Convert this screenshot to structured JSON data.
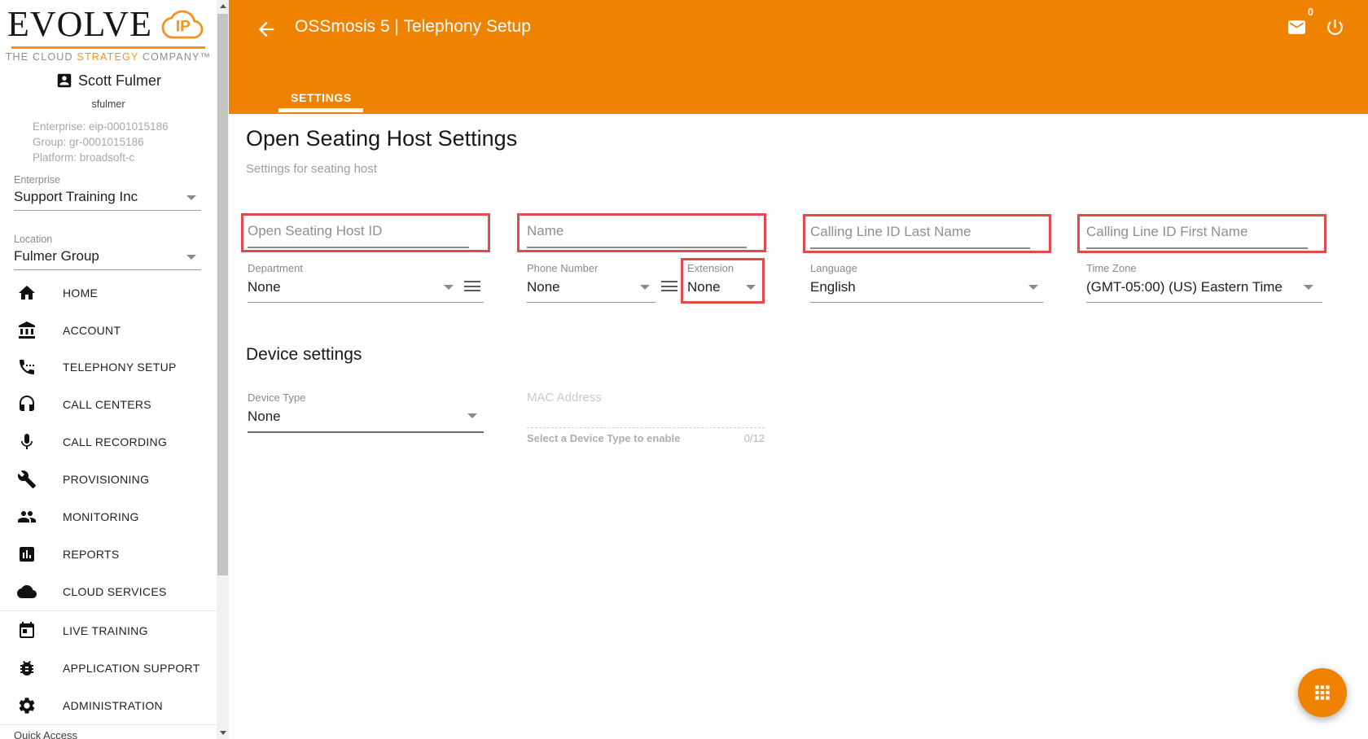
{
  "colors": {
    "accent_orange": "#EF8201",
    "brand_orange": "#F6921E",
    "highlight_red": "#E14B4B"
  },
  "sidebar": {
    "logo": {
      "brand": "EVOLVE",
      "ip": "IP",
      "tagline_pre": "THE CLOUD ",
      "tagline_accent": "STRATEGY",
      "tagline_post": " COMPANY™"
    },
    "user": {
      "name": "Scott Fulmer",
      "username": "sfulmer",
      "enterprise_line": "Enterprise: eip-0001015186",
      "group_line": "Group: gr-0001015186",
      "platform_line": "Platform: broadsoft-c"
    },
    "enterprise": {
      "label": "Enterprise",
      "value": "Support Training Inc"
    },
    "location": {
      "label": "Location",
      "value": "Fulmer Group"
    },
    "nav": [
      {
        "label": "HOME",
        "icon": "home-icon"
      },
      {
        "label": "ACCOUNT",
        "icon": "bank-icon"
      },
      {
        "label": "TELEPHONY SETUP",
        "icon": "phone-settings-icon"
      },
      {
        "label": "CALL CENTERS",
        "icon": "headset-icon"
      },
      {
        "label": "CALL RECORDING",
        "icon": "microphone-icon"
      },
      {
        "label": "PROVISIONING",
        "icon": "wrench-icon"
      },
      {
        "label": "MONITORING",
        "icon": "people-icon"
      },
      {
        "label": "REPORTS",
        "icon": "bar-chart-icon"
      },
      {
        "label": "CLOUD SERVICES",
        "icon": "cloud-icon"
      },
      {
        "label": "LIVE TRAINING",
        "icon": "calendar-icon"
      },
      {
        "label": "APPLICATION SUPPORT",
        "icon": "bug-icon"
      },
      {
        "label": "ADMINISTRATION",
        "icon": "gear-icon"
      }
    ],
    "quick_access": "Quick Access"
  },
  "header": {
    "title": "OSSmosis 5 | Telephony Setup",
    "mail_badge": "0",
    "tab": "SETTINGS"
  },
  "content": {
    "title": "Open Seating Host Settings",
    "subtitle": "Settings for seating host",
    "fields": {
      "host_id": {
        "placeholder": "Open Seating Host ID"
      },
      "name": {
        "placeholder": "Name"
      },
      "clid_last": {
        "placeholder": "Calling Line ID Last Name"
      },
      "clid_first": {
        "placeholder": "Calling Line ID First Name"
      },
      "department": {
        "label": "Department",
        "value": "None"
      },
      "phone_number": {
        "label": "Phone Number",
        "value": "None"
      },
      "extension": {
        "label": "Extension",
        "value": "None"
      },
      "language": {
        "label": "Language",
        "value": "English"
      },
      "time_zone": {
        "label": "Time Zone",
        "value": "(GMT-05:00) (US) Eastern Time"
      }
    },
    "device": {
      "title": "Device settings",
      "device_type": {
        "label": "Device Type",
        "value": "None"
      },
      "mac": {
        "label": "MAC Address",
        "helper": "Select a Device Type to enable",
        "counter": "0/12"
      }
    }
  }
}
